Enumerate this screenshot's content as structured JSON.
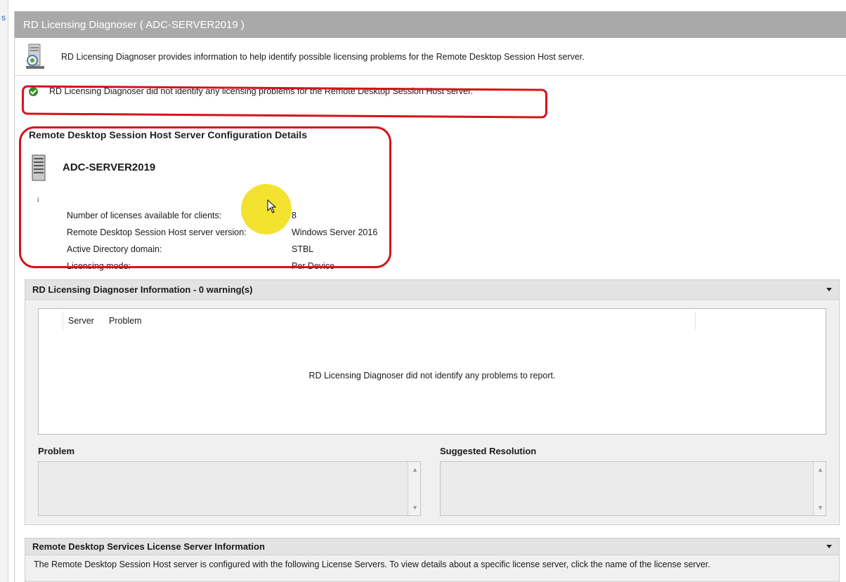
{
  "left_strip_char": "s",
  "window": {
    "title": "RD Licensing Diagnoser ( ADC-SERVER2019 )",
    "intro": "RD Licensing Diagnoser provides information to help identify possible licensing problems for the Remote Desktop Session Host server.",
    "status": "RD Licensing Diagnoser did not identify any licensing problems for the Remote Desktop Session Host server."
  },
  "config": {
    "section_title": "Remote Desktop Session Host Server Configuration Details",
    "server_name": "ADC-SERVER2019",
    "rows": [
      {
        "label": "Number of licenses available for clients:",
        "value": "8"
      },
      {
        "label": "Remote Desktop Session Host server version:",
        "value": "Windows Server 2016"
      },
      {
        "label": "Active Directory domain:",
        "value": "STBL"
      },
      {
        "label": "Licensing mode:",
        "value": "Per Device"
      }
    ]
  },
  "diag_panel": {
    "title": "RD Licensing Diagnoser Information - 0 warning(s)",
    "columns": [
      "Server",
      "Problem"
    ],
    "empty_message": "RD Licensing Diagnoser did not identify any problems to report.",
    "problem_label": "Problem",
    "resolution_label": "Suggested Resolution"
  },
  "license_panel": {
    "title": "Remote Desktop Services License Server Information",
    "body": "The Remote Desktop Session Host server is configured with the following License Servers. To view details about a specific license server, click the name of the license server."
  },
  "colors": {
    "titlebar": "#a9a9a9",
    "annotation": "#d4121b",
    "highlight": "#f2df1a",
    "status_ok": "#3a8a2e"
  }
}
